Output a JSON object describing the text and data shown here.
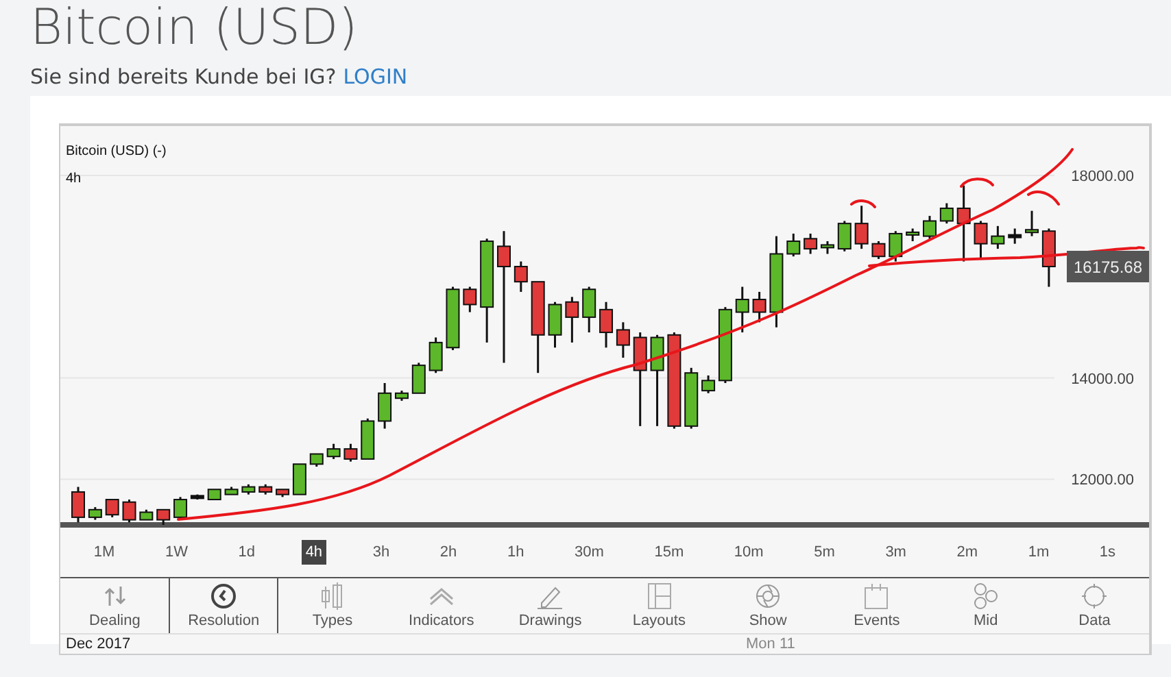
{
  "page_title": "Bitcoin (USD)",
  "login_prompt": {
    "text": "Sie sind bereits Kunde bei IG?",
    "link": "LOGIN"
  },
  "chart": {
    "interval": "4h",
    "price_tag": "16175.68",
    "chart_data": {
      "type": "candlestick",
      "title": "Bitcoin (USD) (-)",
      "grid": true,
      "ylim": [
        11100,
        19000
      ],
      "yticks": [
        {
          "value": 12000,
          "label": "12000.00"
        },
        {
          "value": 14000,
          "label": "14000.00"
        },
        {
          "value": 18000,
          "label": "18000.00"
        }
      ],
      "ohlc": [
        [
          11750,
          11850,
          11150,
          11250
        ],
        [
          11250,
          11450,
          11200,
          11400
        ],
        [
          11600,
          11600,
          11250,
          11300
        ],
        [
          11550,
          11600,
          11150,
          11200
        ],
        [
          11200,
          11400,
          11200,
          11350
        ],
        [
          11400,
          11400,
          11100,
          11200
        ],
        [
          11250,
          11650,
          11200,
          11600
        ],
        [
          11650,
          11700,
          11600,
          11650
        ],
        [
          11600,
          11800,
          11600,
          11800
        ],
        [
          11700,
          11850,
          11700,
          11800
        ],
        [
          11750,
          11900,
          11700,
          11850
        ],
        [
          11850,
          11900,
          11700,
          11750
        ],
        [
          11800,
          11800,
          11650,
          11700
        ],
        [
          11700,
          12300,
          11700,
          12300
        ],
        [
          12300,
          12500,
          12250,
          12500
        ],
        [
          12450,
          12700,
          12400,
          12600
        ],
        [
          12600,
          12700,
          12350,
          12400
        ],
        [
          12400,
          13200,
          12400,
          13150
        ],
        [
          13150,
          13900,
          13000,
          13700
        ],
        [
          13600,
          13750,
          13550,
          13700
        ],
        [
          13700,
          14300,
          13700,
          14250
        ],
        [
          14150,
          14800,
          14100,
          14700
        ],
        [
          14600,
          15800,
          14550,
          15750
        ],
        [
          15750,
          15800,
          15300,
          15450
        ],
        [
          15400,
          16750,
          14700,
          16700
        ],
        [
          16600,
          16900,
          14300,
          16200
        ],
        [
          16200,
          16300,
          15700,
          15900
        ],
        [
          15900,
          15900,
          14100,
          14850
        ],
        [
          14850,
          15500,
          14600,
          15450
        ],
        [
          15500,
          15600,
          14700,
          15200
        ],
        [
          15200,
          15800,
          14900,
          15750
        ],
        [
          15350,
          15500,
          14600,
          14900
        ],
        [
          14950,
          15100,
          14400,
          14650
        ],
        [
          14800,
          14900,
          13050,
          14150
        ],
        [
          14150,
          14850,
          13050,
          14800
        ],
        [
          14850,
          14900,
          13000,
          13050
        ],
        [
          13050,
          14200,
          13000,
          14100
        ],
        [
          13750,
          14050,
          13700,
          13950
        ],
        [
          13950,
          15400,
          13900,
          15350
        ],
        [
          15300,
          15800,
          14900,
          15550
        ],
        [
          15550,
          15700,
          15100,
          15300
        ],
        [
          15300,
          16800,
          15000,
          16450
        ],
        [
          16450,
          16850,
          16400,
          16700
        ],
        [
          16750,
          16850,
          16450,
          16550
        ],
        [
          16550,
          16700,
          16450,
          16600
        ],
        [
          16550,
          17100,
          16500,
          17050
        ],
        [
          17050,
          17400,
          16550,
          16650
        ],
        [
          16650,
          16700,
          16350,
          16400
        ],
        [
          16400,
          16900,
          16300,
          16850
        ],
        [
          16800,
          16950,
          16700,
          16850
        ],
        [
          16800,
          17200,
          16750,
          17100
        ],
        [
          17100,
          17450,
          17050,
          17350
        ],
        [
          17350,
          17800,
          16300,
          17050
        ],
        [
          17050,
          17100,
          16350,
          16650
        ],
        [
          16650,
          17000,
          16550,
          16800
        ],
        [
          16800,
          16950,
          16650,
          16800
        ],
        [
          16850,
          17300,
          16800,
          16900
        ],
        [
          16900,
          16950,
          15800,
          16200
        ]
      ]
    }
  },
  "timeframes": [
    {
      "label": "1M",
      "selected": false
    },
    {
      "label": "1W",
      "selected": false
    },
    {
      "label": "1d",
      "selected": false
    },
    {
      "label": "4h",
      "selected": true
    },
    {
      "label": "3h",
      "selected": false
    },
    {
      "label": "2h",
      "selected": false
    },
    {
      "label": "1h",
      "selected": false
    },
    {
      "label": "30m",
      "selected": false
    },
    {
      "label": "15m",
      "selected": false
    },
    {
      "label": "10m",
      "selected": false
    },
    {
      "label": "5m",
      "selected": false
    },
    {
      "label": "3m",
      "selected": false
    },
    {
      "label": "2m",
      "selected": false
    },
    {
      "label": "1m",
      "selected": false
    },
    {
      "label": "1s",
      "selected": false
    }
  ],
  "toolbar": [
    {
      "label": "Dealing",
      "kind": "dealing",
      "selected": false
    },
    {
      "label": "Resolution",
      "kind": "resolution",
      "selected": true
    },
    {
      "label": "Types",
      "kind": "types",
      "selected": false
    },
    {
      "label": "Indicators",
      "kind": "indicators",
      "selected": false
    },
    {
      "label": "Drawings",
      "kind": "drawings",
      "selected": false
    },
    {
      "label": "Layouts",
      "kind": "layouts",
      "selected": false
    },
    {
      "label": "Show",
      "kind": "show",
      "selected": false
    },
    {
      "label": "Events",
      "kind": "events",
      "selected": false
    },
    {
      "label": "Mid",
      "kind": "mid",
      "selected": false
    },
    {
      "label": "Data",
      "kind": "data",
      "selected": false
    }
  ],
  "date_axis": {
    "month": "Dec 2017",
    "day": "Mon 11"
  }
}
